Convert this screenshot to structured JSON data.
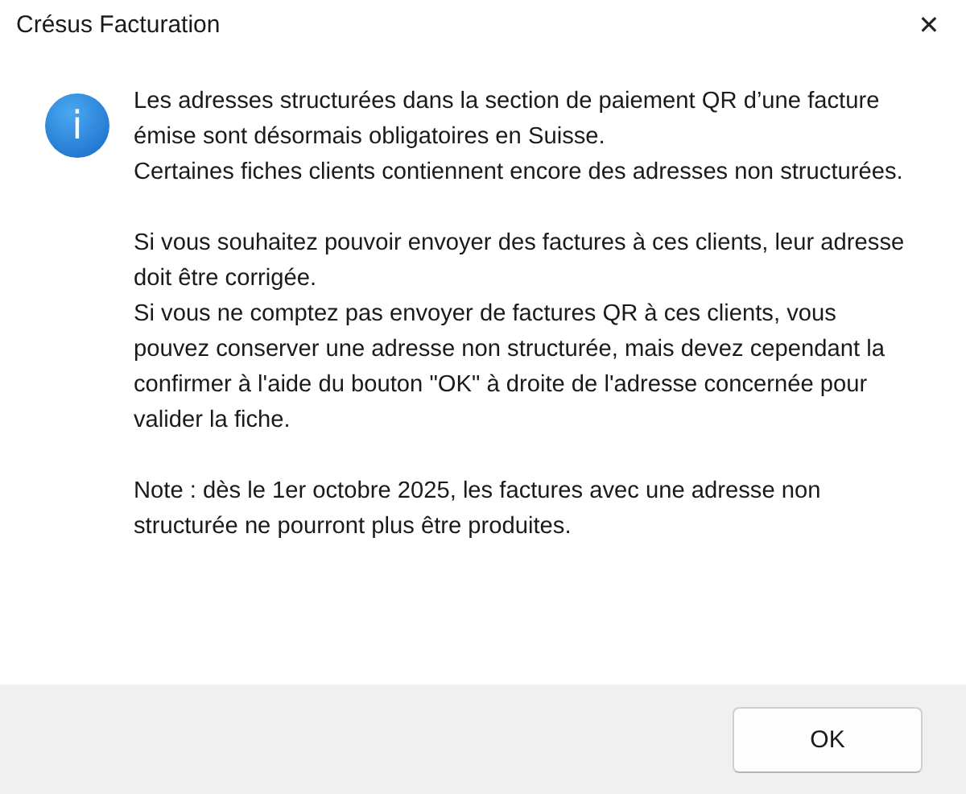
{
  "window": {
    "title": "Crésus Facturation",
    "close": "✕"
  },
  "message": {
    "icon": "i",
    "paragraphs": [
      [
        "Les adresses structurées dans la section de paiement QR d’une facture émise sont désormais obligatoires en Suisse.",
        "Certaines fiches clients contiennent encore des adresses non structurées."
      ],
      [
        "Si vous souhaitez pouvoir envoyer des factures à ces clients, leur adresse doit être corrigée.",
        "Si vous ne comptez pas envoyer de factures QR à ces clients, vous pouvez conserver une adresse non structurée, mais devez cependant la confirmer à l'aide du bouton \"OK\" à droite de l'adresse concernée pour valider la fiche."
      ],
      [
        "Note : dès le 1er octobre 2025, les factures avec une adresse non structurée ne pourront plus être produites."
      ]
    ]
  },
  "buttons": [
    "OK"
  ]
}
